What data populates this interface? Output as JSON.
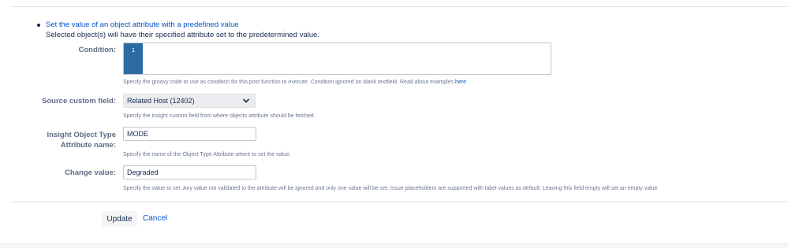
{
  "function": {
    "title": "Set the value of an object attribute with a predefined value",
    "description": "Selected object(s) will have their specified attribute set to the predetermined value."
  },
  "condition": {
    "label": "Condition:",
    "line_number": "1",
    "code": "",
    "help_text": "Specify the groovy code to use as condition for this post function to execute. Condition ignored on blank textfield. Read about examples",
    "help_link": "here"
  },
  "source_field": {
    "label": "Source custom field:",
    "selected": "Related Host (12402)",
    "help_text": "Specify the insight custom field from where objects attribute should be fetched."
  },
  "attribute_name": {
    "label": "Insight Object Type Attribute name:",
    "value": "MODE",
    "help_text": "Specify the name of the Object Type Attribute where to set the value."
  },
  "change_value": {
    "label": "Change value:",
    "value": "Degraded",
    "help_text": "Specify the value to set. Any value not validated to the attribute will be ignored and only one value will be set. Issue placeholders are supported with label values as default. Leaving this field empty will set an empty value."
  },
  "actions": {
    "update_label": "Update",
    "cancel_label": "Cancel"
  },
  "colors": {
    "link": "#0052cc",
    "gutter": "#2d6ca2",
    "text": "#172b4d",
    "label": "#5e6c84"
  },
  "icons": {
    "select_arrow": "chevron-down-icon",
    "bullet": "bullet-icon"
  }
}
